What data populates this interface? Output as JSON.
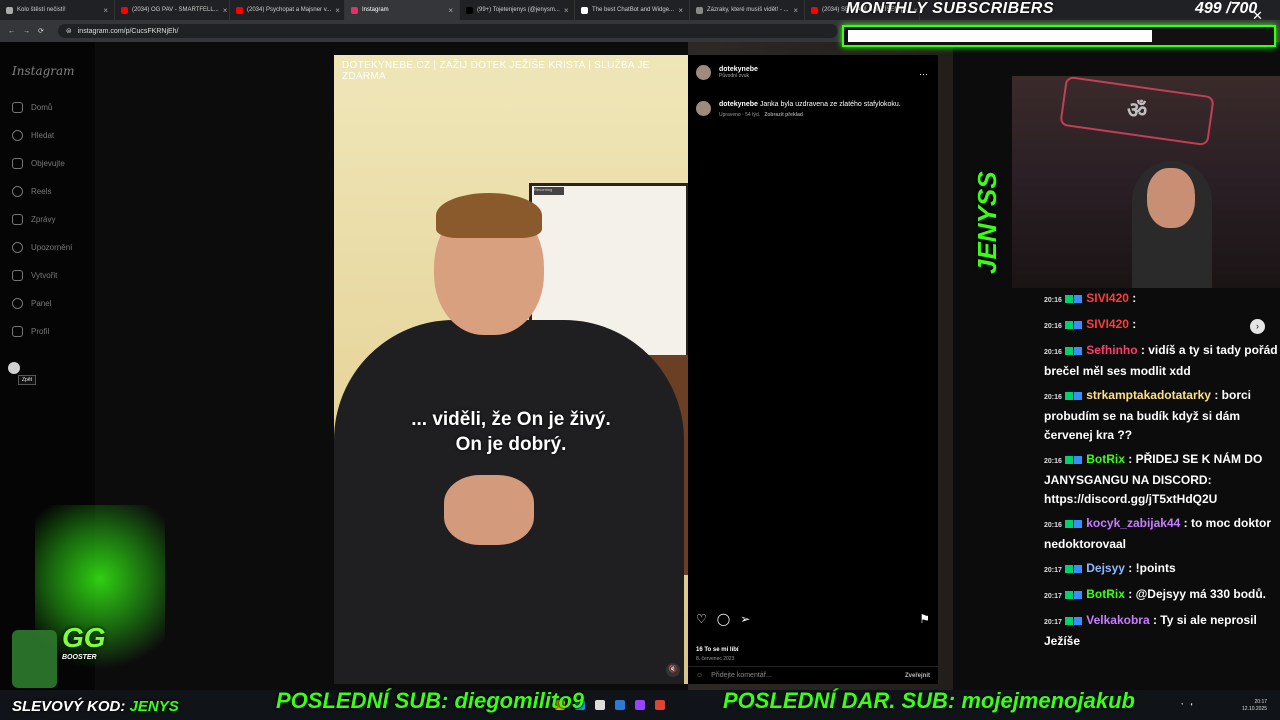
{
  "browser": {
    "tabs": [
      {
        "label": "Kolo štěstí nečistí!",
        "color": "#aaaaaa"
      },
      {
        "label": "(2034) OG PAV - SMARTFELL...",
        "color": "#ff0000"
      },
      {
        "label": "(2034) Psychopat a Majsner v...",
        "color": "#ff0000"
      },
      {
        "label": "Instagram",
        "color": "#e1306c",
        "active": true
      },
      {
        "label": "(99+) Tojetenjenys (@jenysm...",
        "color": "#000000"
      },
      {
        "label": "The best ChatBot and Widge...",
        "color": "#ffffff"
      },
      {
        "label": "Zázraky, které musíš vidět! - ...",
        "color": "#888888"
      },
      {
        "label": "(2034) SETKÁNÍ S JEŽÍŠEM p...",
        "color": "#ff0000"
      }
    ],
    "url": "instagram.com/p/CucsFKRNjEh/"
  },
  "instagram": {
    "logo": "Instagram",
    "nav": [
      "Domů",
      "Hledat",
      "Objevujte",
      "Reels",
      "Zprávy",
      "Upozornění",
      "Vytvořit",
      "Panel",
      "Profil"
    ],
    "back_tooltip": "Zpět",
    "video": {
      "top_text": "DOTEKYNEBE.CZ | ZAŽIJ DOTEK JEŽÍŠE KRISTA | SLUŽBA JE ZDARMA",
      "subtitle_line1": "... viděli, že On je živý.",
      "subtitle_line2": "On je dobrý.",
      "recording_label": "Recording"
    },
    "post": {
      "username": "dotekynebe",
      "audio": "Původní zvuk",
      "caption_user": "dotekynebe",
      "caption": "Janka byla uzdravena ze zlatého stafylokoku.",
      "caption_meta": "Upraveno · 54 týd.",
      "translate": "Zobrazit překlad",
      "likes": "16 To se mi líbí",
      "date": "8. červenec 2023",
      "comment_placeholder": "Přidejte komentář...",
      "publish": "Zveřejnit"
    }
  },
  "stream": {
    "monthly_label": "MONTHLY SUBSCRIBERS",
    "goal": "499 /700",
    "goal_progress": 0.713,
    "jenyss_logo": "JENYSS",
    "chat": [
      {
        "time": "20:16",
        "user": "SIVI420",
        "color": "#ff3b3b",
        "text": ":"
      },
      {
        "time": "20:16",
        "user": "SIVI420",
        "color": "#ff3b3b",
        "text": ":"
      },
      {
        "time": "20:16",
        "user": "Sefhinho",
        "color": "#ff3b6b",
        "text": ": vidíš a ty si tady pořád brečel měl ses modlit xdd"
      },
      {
        "time": "20:16",
        "user": "strkamptakadotatarky",
        "color": "#ffe08a",
        "text": ": borci probudím se na budík když si dám červenej kra ??"
      },
      {
        "time": "20:16",
        "user": "BotRix",
        "color": "#39ff14",
        "text": ": PŘIDEJ SE K NÁM DO JANYSGANGU NA DISCORD: https://discord.gg/jT5xtHdQ2U"
      },
      {
        "time": "20:16",
        "user": "kocyk_zabijak44",
        "color": "#c77dff",
        "text": ": to moc doktor nedoktorovaal"
      },
      {
        "time": "20:17",
        "user": "Dejsyy",
        "color": "#8fb8ff",
        "text": ": !points"
      },
      {
        "time": "20:17",
        "user": "BotRix",
        "color": "#39ff14",
        "text": ": @Dejsyy má 330 bodů."
      },
      {
        "time": "20:17",
        "user": "Velkakobra",
        "color": "#c77dff",
        "text": ": Ty si ale neprosil Ježíše"
      }
    ],
    "bottom_left_label": "SLEVOVÝ KOD:",
    "bottom_left_code": "JENYS",
    "last_sub": "POSLEDNÍ SUB: diegomilito9",
    "last_dar": "POSLEDNÍ DAR. SUB: mojejmenojakub",
    "gg_label": "GG",
    "booster_label": "BOOSTER"
  },
  "taskbar": {
    "time": "20:17",
    "date": "12.10.2025"
  }
}
